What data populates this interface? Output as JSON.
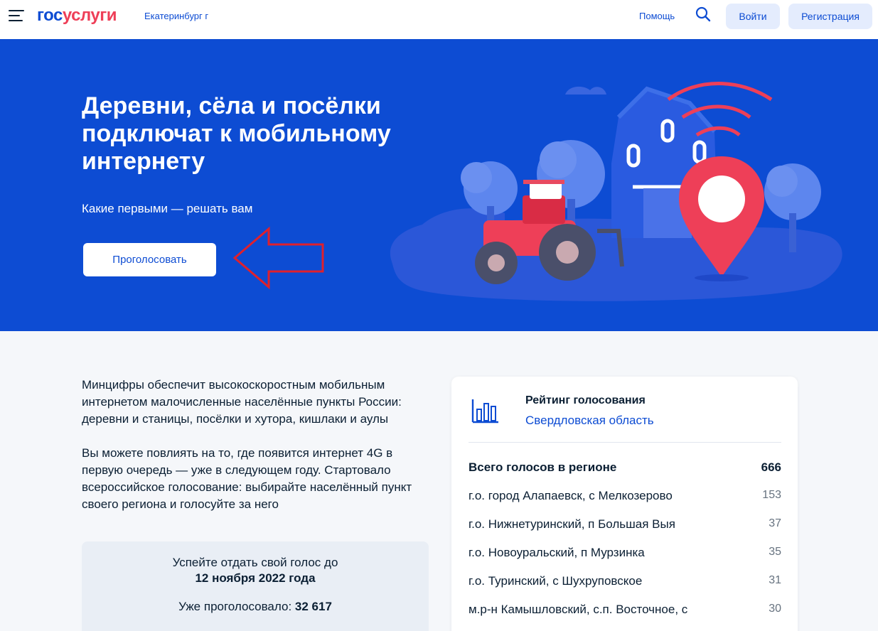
{
  "header": {
    "logo_part1": "гос",
    "logo_part2": "услуги",
    "city": "Екатеринбург г",
    "help_label": "Помощь",
    "login_label": "Войти",
    "register_label": "Регистрация"
  },
  "hero": {
    "title": "Деревни, сёла и посёлки подключат к мобильному интернету",
    "subtitle": "Какие первыми — решать вам",
    "vote_button_label": "Проголосовать"
  },
  "intro": {
    "paragraph1": "Минцифры обеспечит высокоскоростным мобильным интернетом малочисленные населённые пункты России: деревни и станицы, посёлки и хутора, кишлаки и аулы",
    "paragraph2": "Вы можете повлиять на то, где появится интернет 4G в первую очередь — уже в следующем году. Стартовало всероссийское голосование: выбирайте населённый пункт своего региона и голосуйте за него"
  },
  "deadline": {
    "text": "Успейте отдать свой голос до",
    "date": "12 ноября 2022 года",
    "voted_label": "Уже проголосовало:",
    "voted_count": "32 617"
  },
  "rating": {
    "title": "Рейтинг голосования",
    "region": "Свердловская область",
    "total_label": "Всего голосов в регионе",
    "total_count": "666",
    "rows": [
      {
        "name": "г.о. город Алапаевск, с Мелкозерово",
        "count": "153"
      },
      {
        "name": "г.о. Нижнетуринский, п Большая Выя",
        "count": "37"
      },
      {
        "name": "г.о. Новоуральский, п Мурзинка",
        "count": "35"
      },
      {
        "name": "г.о. Туринский, с Шухруповское",
        "count": "31"
      },
      {
        "name": "м.р-н Камышловский, с.п. Восточное, с",
        "count": "30"
      }
    ]
  },
  "colors": {
    "brand_blue": "#0d4cd3",
    "brand_red": "#ee3f58",
    "arrow_red": "#e0202c"
  }
}
